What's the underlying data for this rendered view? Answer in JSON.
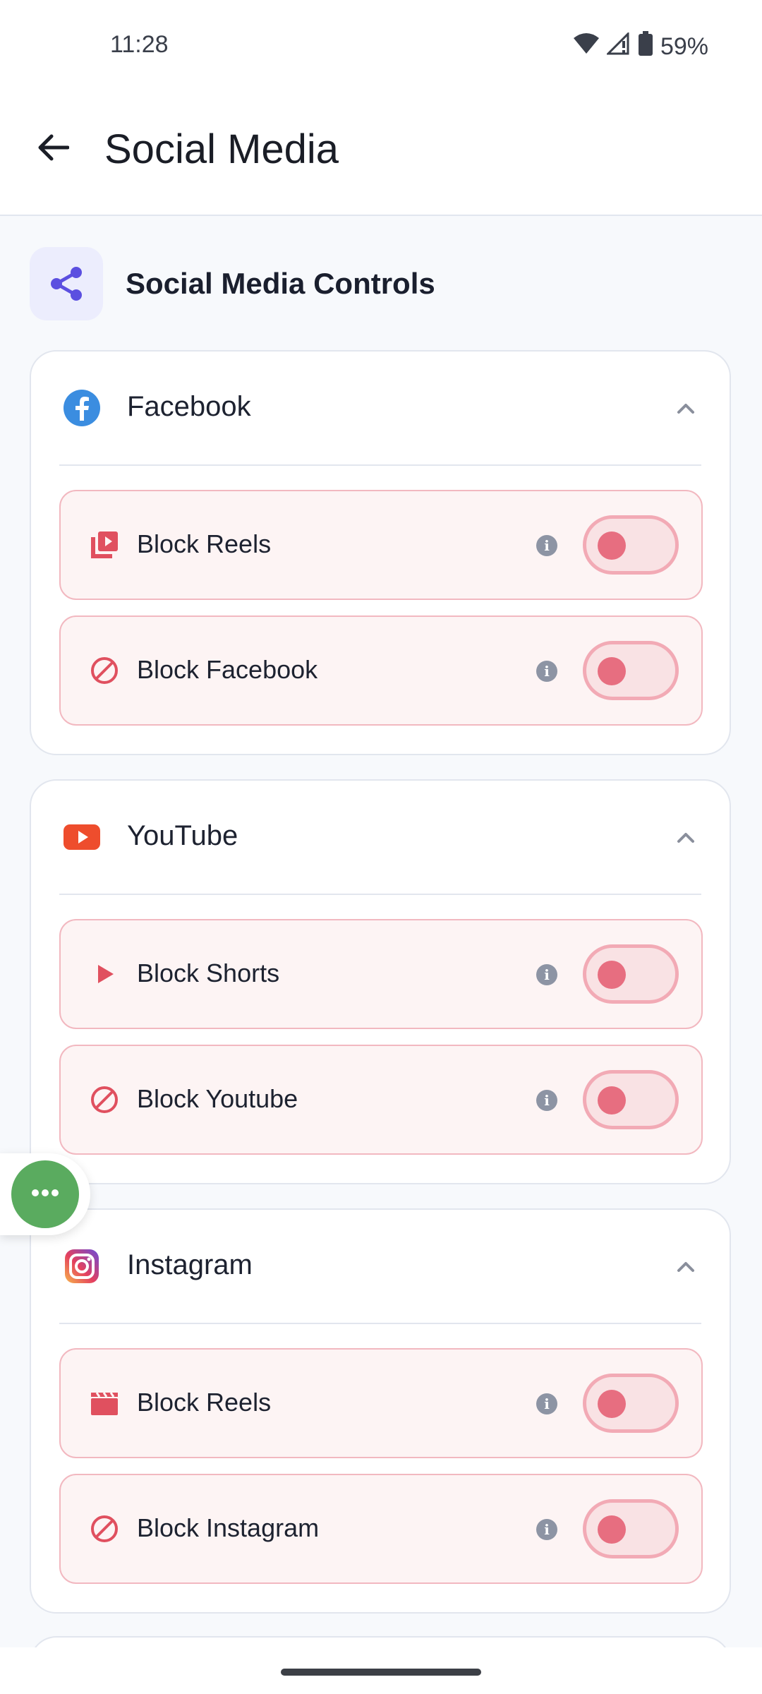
{
  "status_bar": {
    "time": "11:28",
    "battery": "59%"
  },
  "app_bar": {
    "title": "Social Media"
  },
  "section": {
    "title": "Social Media Controls"
  },
  "cards": [
    {
      "name": "Facebook",
      "rows": [
        {
          "label": "Block Reels",
          "enabled": false
        },
        {
          "label": "Block Facebook",
          "enabled": false
        }
      ]
    },
    {
      "name": "YouTube",
      "rows": [
        {
          "label": "Block Shorts",
          "enabled": false
        },
        {
          "label": "Block Youtube",
          "enabled": false
        }
      ]
    },
    {
      "name": "Instagram",
      "rows": [
        {
          "label": "Block Reels",
          "enabled": false
        },
        {
          "label": "Block Instagram",
          "enabled": false
        }
      ]
    }
  ],
  "colors": {
    "accent": "#5b4fe0",
    "facebook": "#3b8de0",
    "youtube": "#ee4d2d",
    "block_red": "#e0505f",
    "fab_green": "#5aab5f"
  }
}
